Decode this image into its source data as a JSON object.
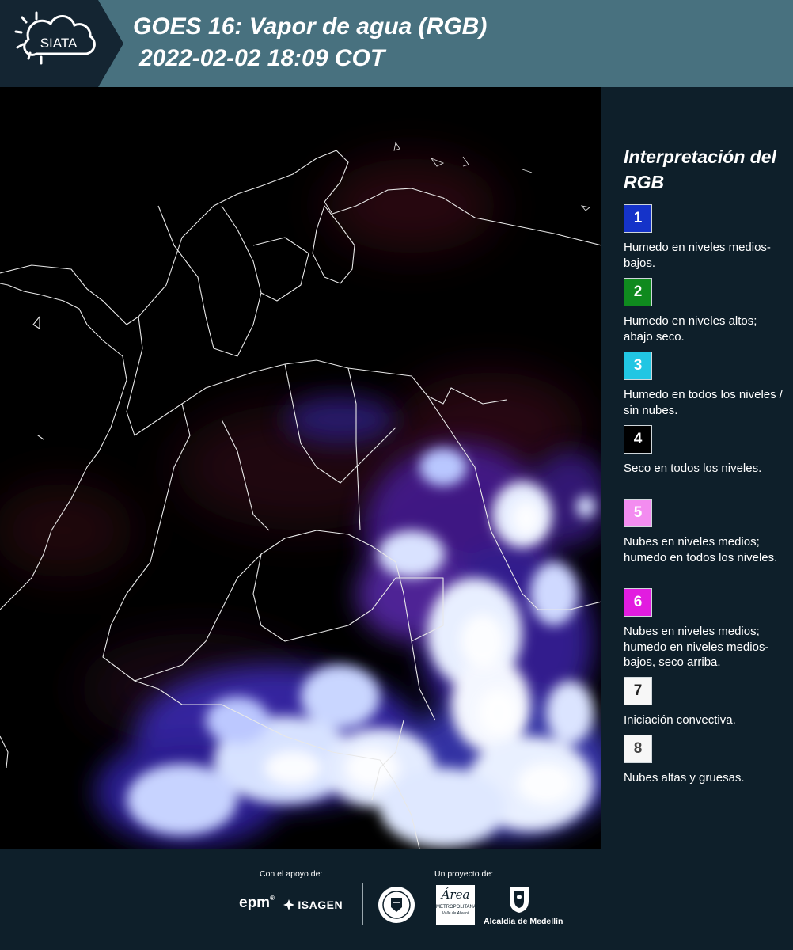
{
  "header": {
    "logo_text": "SIATA",
    "title_line1": "GOES 16: Vapor de agua (RGB)",
    "title_line2": "2022-02-02 18:09 COT"
  },
  "legend": {
    "title": "Interpretación del RGB",
    "items": [
      {
        "number": "1",
        "color": "#1533c9",
        "text_color": "#ffffff",
        "description": "Humedo en niveles medios-bajos."
      },
      {
        "number": "2",
        "color": "#0f8a1e",
        "text_color": "#ffffff",
        "description": "Humedo en niveles altos; abajo seco."
      },
      {
        "number": "3",
        "color": "#21c6e3",
        "text_color": "#ffffff",
        "description": "Humedo en todos los niveles / sin nubes."
      },
      {
        "number": "4",
        "color": "#000000",
        "text_color": "#ffffff",
        "description": "Seco en todos los niveles."
      },
      {
        "number": "5",
        "color": "#f38cf0",
        "text_color": "#ffffff",
        "description": "Nubes en niveles medios; humedo en todos los niveles."
      },
      {
        "number": "6",
        "color": "#e21ce0",
        "text_color": "#ffffff",
        "description": "Nubes en niveles medios; humedo en niveles medios-bajos, seco arriba."
      },
      {
        "number": "7",
        "color": "#f7f7f7",
        "text_color": "#222222",
        "description": "Iniciación convectiva."
      },
      {
        "number": "8",
        "color": "#f7f7f7",
        "text_color": "#444444",
        "description": "Nubes altas y gruesas."
      }
    ]
  },
  "footer": {
    "support_label": "Con el apoyo de:",
    "project_label": "Un proyecto de:",
    "epm_text": "epm",
    "isagen_text": "ISAGEN",
    "area_text": "Área",
    "area_subtext": "METROPOLITANA",
    "area_subtext2": "Valle de Aburrá",
    "alcaldia_text": "Alcaldía de Medellín"
  }
}
